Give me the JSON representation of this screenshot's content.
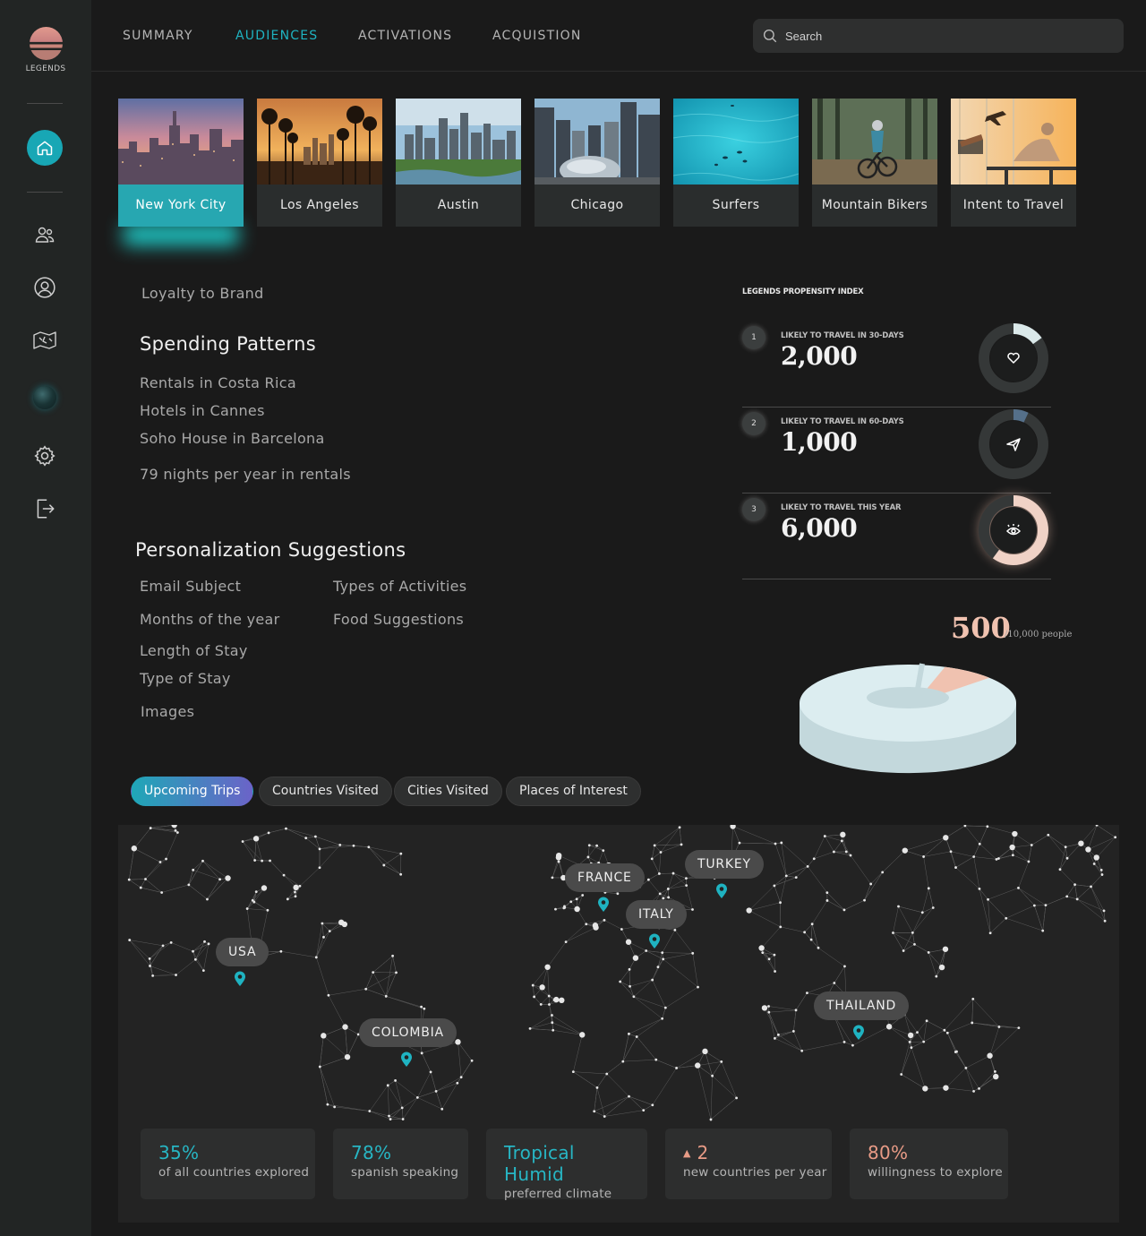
{
  "brand": {
    "name": "LEGENDS"
  },
  "nav": {
    "tabs": [
      "SUMMARY",
      "AUDIENCES",
      "ACTIVATIONS",
      "ACQUISTION"
    ],
    "active_tab": "AUDIENCES",
    "search_placeholder": "Search"
  },
  "sidebar": {
    "icons": [
      "home-icon",
      "users-icon",
      "user-circle-icon",
      "map-icon",
      "globe-icon",
      "settings-icon",
      "logout-icon"
    ]
  },
  "audiences": [
    {
      "label": "New York City",
      "active": true
    },
    {
      "label": "Los Angeles"
    },
    {
      "label": "Austin"
    },
    {
      "label": "Chicago"
    },
    {
      "label": "Surfers"
    },
    {
      "label": "Mountain Bikers"
    },
    {
      "label": "Intent to Travel"
    }
  ],
  "insights": {
    "loyalty": "Loyalty to Brand",
    "spending_title": "Spending Patterns",
    "spending_items": [
      "Rentals in Costa Rica",
      "Hotels in Cannes",
      "Soho House in Barcelona"
    ],
    "nights": "79 nights per year in rentals",
    "personalization_title": "Personalization Suggestions",
    "personalization_left": [
      "Email Subject",
      "Months of the year",
      "Length of Stay",
      "Type of Stay",
      "Images"
    ],
    "personalization_right": [
      "Types of Activities",
      "Food Suggestions"
    ]
  },
  "propensity": {
    "title": "LEGENDS PROPENSITY INDEX",
    "rows": [
      {
        "rank": "1",
        "label": "LIKELY TO TRAVEL IN 30-DAYS",
        "value": "2,000",
        "icon": "heart-icon",
        "fill": 0.15
      },
      {
        "rank": "2",
        "label": "LIKELY TO TRAVEL IN 60-DAYS",
        "value": "1,000",
        "icon": "send-icon",
        "fill": 0.07
      },
      {
        "rank": "3",
        "label": "LIKELY TO TRAVEL THIS YEAR",
        "value": "6,000",
        "icon": "eye-icon",
        "fill": 0.6
      }
    ],
    "total_value": "500",
    "total_suffix": "/10,000 people",
    "colors": {
      "accent": "#1fb3c1",
      "peach": "#f0c2b0",
      "pie": "#dcedf0"
    }
  },
  "chart_data": {
    "type": "pie",
    "categories": [
      "selected",
      "remaining"
    ],
    "values": [
      500,
      9500
    ]
  },
  "map_tabs": [
    "Upcoming Trips",
    "Countries Visited",
    "Cities Visited",
    "Places of Interest"
  ],
  "map_active_tab": "Upcoming Trips",
  "countries": [
    "USA",
    "COLOMBIA",
    "FRANCE",
    "ITALY",
    "TURKEY",
    "THAILAND"
  ],
  "stats": [
    {
      "value": "35%",
      "desc": "of all countries explored"
    },
    {
      "value": "78%",
      "desc": "spanish speaking"
    },
    {
      "value": "Tropical Humid",
      "desc": "preferred climate"
    },
    {
      "value": "2",
      "desc": "new countries per year",
      "trend": "up"
    },
    {
      "value": "80%",
      "desc": "willingness to explore"
    }
  ]
}
